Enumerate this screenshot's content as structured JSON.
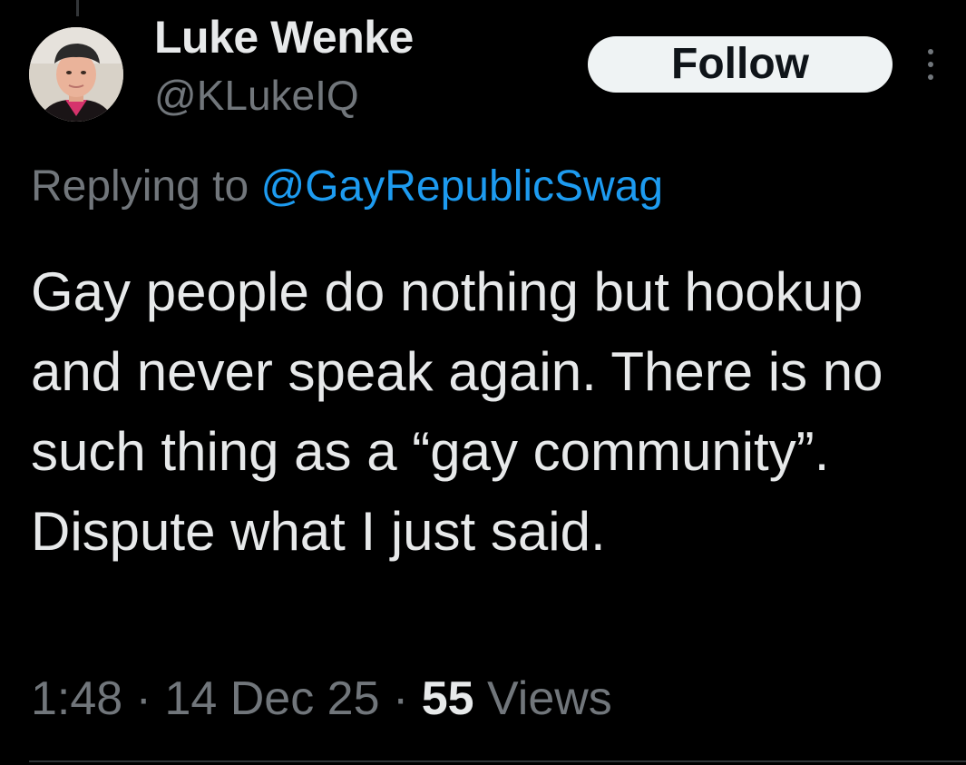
{
  "author": {
    "display_name": "Luke Wenke",
    "handle": "@KLukeIQ"
  },
  "follow_label": "Follow",
  "reply": {
    "prefix": "Replying to ",
    "mention": "@GayRepublicSwag"
  },
  "tweet": {
    "text": "Gay people do nothing but hookup and never speak again. There is no such thing as a “gay community”.  Dispute what I just said."
  },
  "meta": {
    "time": "1:48",
    "separator": "·",
    "date": "14 Dec 25",
    "views_count": "55",
    "views_label": "Views"
  },
  "icons": {
    "more": "more-vertical-icon",
    "avatar": "avatar"
  },
  "colors": {
    "background": "#000000",
    "primary_text": "#e7e9ea",
    "secondary_text": "#71767b",
    "link": "#1d9bf0",
    "follow_bg": "#eff3f4"
  }
}
